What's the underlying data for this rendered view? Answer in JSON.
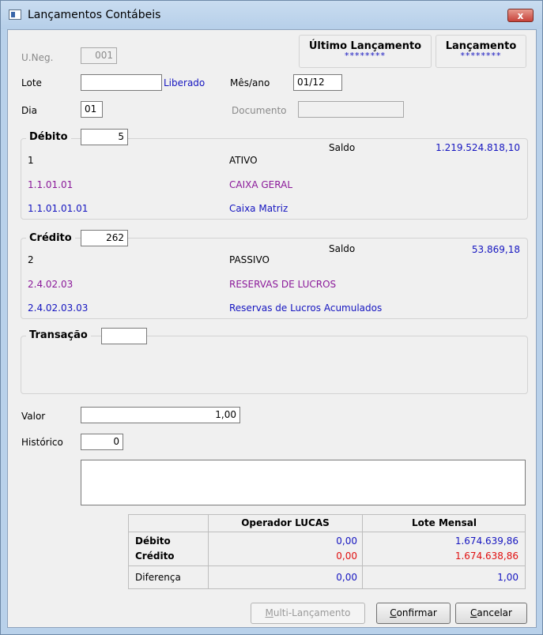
{
  "window": {
    "title": "Lançamentos Contábeis",
    "close_label": "x"
  },
  "header": {
    "uneg_label": "U.Neg.",
    "uneg_value": "001",
    "ultimo_title": "Último Lançamento",
    "ultimo_value": "********",
    "lanc_title": "Lançamento",
    "lanc_value": "********",
    "lote_label": "Lote",
    "lote_value": "",
    "liberado_label": "Liberado",
    "mesano_label": "Mês/ano",
    "mesano_value": "01/12",
    "dia_label": "Dia",
    "dia_value": "01",
    "documento_label": "Documento",
    "documento_value": ""
  },
  "debito": {
    "legend": "Débito",
    "code": "5",
    "saldo_label": "Saldo",
    "saldo_value": "1.219.524.818,10",
    "rows": [
      {
        "account": "1",
        "name": "ATIVO"
      },
      {
        "account": "1.1.01.01",
        "name": "CAIXA GERAL"
      },
      {
        "account": "1.1.01.01.01",
        "name": "Caixa Matriz"
      }
    ]
  },
  "credito": {
    "legend": "Crédito",
    "code": "262",
    "saldo_label": "Saldo",
    "saldo_value": "53.869,18",
    "rows": [
      {
        "account": "2",
        "name": "PASSIVO"
      },
      {
        "account": "2.4.02.03",
        "name": "RESERVAS DE LUCROS"
      },
      {
        "account": "2.4.02.03.03",
        "name": "Reservas de Lucros Acumulados"
      }
    ]
  },
  "transacao": {
    "legend": "Transação",
    "value": ""
  },
  "valor": {
    "label": "Valor",
    "value": "1,00"
  },
  "historico": {
    "label": "Histórico",
    "code": "0",
    "text": ""
  },
  "summary": {
    "col_operador": "Operador LUCAS",
    "col_lote": "Lote Mensal",
    "debito_label": "Débito",
    "debito_operador": "0,00",
    "debito_lote": "1.674.639,86",
    "credito_label": "Crédito",
    "credito_operador": "0,00",
    "credito_lote": "1.674.638,86",
    "diferenca_label": "Diferença",
    "diferenca_operador": "0,00",
    "diferenca_lote": "1,00"
  },
  "buttons": {
    "multi_prefix": "M",
    "multi_rest": "ulti-Lançamento",
    "confirmar_prefix": "C",
    "confirmar_rest": "onfirmar",
    "cancelar_prefix": "C",
    "cancelar_rest": "ancelar"
  },
  "colors": {
    "blue": "#1515c0",
    "purple": "#8b1a9a",
    "red": "#e01010"
  }
}
